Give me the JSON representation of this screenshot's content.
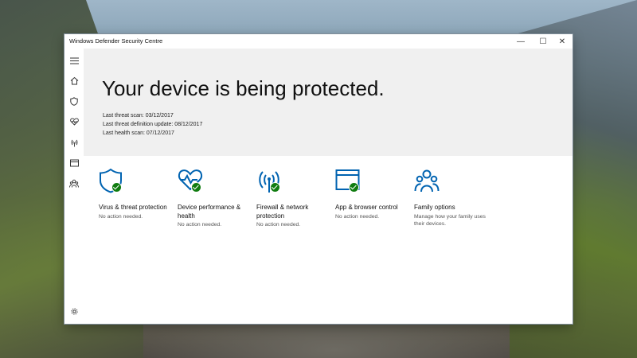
{
  "window": {
    "title": "Windows Defender Security Centre",
    "controls": {
      "minimize": "—",
      "maximize": "☐",
      "close": "✕"
    }
  },
  "sidebar": {
    "items": [
      {
        "icon": "hamburger-menu-icon"
      },
      {
        "icon": "home-icon"
      },
      {
        "icon": "shield-icon"
      },
      {
        "icon": "heart-icon"
      },
      {
        "icon": "wireless-icon"
      },
      {
        "icon": "browser-window-icon"
      },
      {
        "icon": "family-icon"
      }
    ],
    "settings_icon": "gear-icon"
  },
  "hero": {
    "title": "Your device is being protected.",
    "scans": [
      {
        "label": "Last threat scan:",
        "value": "03/12/2017"
      },
      {
        "label": "Last threat definition update:",
        "value": "08/12/2017"
      },
      {
        "label": "Last health scan:",
        "value": "07/12/2017"
      }
    ]
  },
  "tiles": [
    {
      "title": "Virus & threat protection",
      "status": "No action needed.",
      "icon": "shield-icon",
      "ok": true
    },
    {
      "title": "Device performance & health",
      "status": "No action needed.",
      "icon": "heart-icon",
      "ok": true
    },
    {
      "title": "Firewall & network protection",
      "status": "No action needed.",
      "icon": "wireless-icon",
      "ok": true
    },
    {
      "title": "App & browser control",
      "status": "No action needed.",
      "icon": "browser-window-icon",
      "ok": true
    },
    {
      "title": "Family options",
      "status": "Manage how your family uses their devices.",
      "icon": "family-icon",
      "ok": false
    }
  ],
  "colors": {
    "accent": "#0063b1",
    "ok": "#107c10",
    "hero_bg": "#f0f0f0"
  }
}
